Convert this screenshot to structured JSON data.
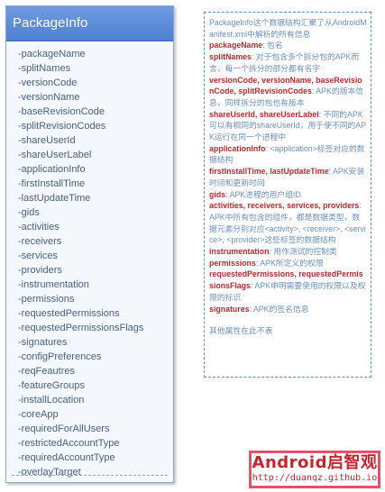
{
  "class_box": {
    "title": "PackageInfo",
    "fields": [
      "-packageName",
      "-splitNames",
      "-versionCode",
      "-versionName",
      "-baseRevisionCode",
      "-splitRevisionCodes",
      "-shareUserId",
      "-shareUserLabel",
      "-applicationInfo",
      "-firstInstallTime",
      "-lastUpdateTime",
      "-gids",
      "-activities",
      "-receivers",
      "-services",
      "-providers",
      "-instrumentation",
      "-permissions",
      "-requestedPermissions",
      "-requestedPermissionsFlags",
      "-signatures",
      "-configPreferences",
      "-reqFeautres",
      "-featureGroups",
      "-installLocation",
      "-coreApp",
      "-requiredForAllUsers",
      "-restrictedAccountType",
      "-requiredAccountType",
      "-overlayTarget"
    ]
  },
  "note": {
    "intro": "PackageInfo这个数据结构汇聚了从AndroidManifest.xml中解析的所有信息",
    "entries": [
      {
        "key": "packageName",
        "desc": ": 包名"
      },
      {
        "key": "splitNames",
        "desc": ": 对于包含多个拆分包的APK而言，每一个拆分的部分都有名字"
      },
      {
        "key": "versionCode, versionName, baseRevisionCode, splitRevisionCodes",
        "desc": ": APK的版本信息，同样拆分的包也有版本"
      },
      {
        "key": "shareUserId, shareUserLabel",
        "desc": ": 不同的APK可以有相同的shareUserId，用于使不同的APK运行在同一个进程中"
      },
      {
        "key": "applicationInfo",
        "desc": ": <application>标签对应的数据结构"
      },
      {
        "key": "firstInstallTime, lastUpdateTime",
        "desc": ": APK安装时间和更新时间"
      },
      {
        "key": "gids",
        "desc": ": APK进程的用户组ID"
      },
      {
        "key": "activities, receivers, services, providers",
        "desc": ": APK中所有包含的组件，都是数据类型，数据元素分别对应<activity>, <receiver>, <service>, <provider>这些标签的数据结构"
      },
      {
        "key": "instrumentation",
        "desc": ": 用作测试的控制类"
      },
      {
        "key": "permissions",
        "desc": ": APK所定义的权限"
      },
      {
        "key": "requestedPermissions, requestedPermissionsFlags",
        "desc": ": APK申明需要使用的权限以及权限的标识"
      },
      {
        "key": "signatures",
        "desc": ": APK的签名信息"
      }
    ],
    "footer": "其他属性在此不表"
  },
  "stamp": {
    "title": "Android启智观",
    "url": "http://duanqz.github.io"
  }
}
